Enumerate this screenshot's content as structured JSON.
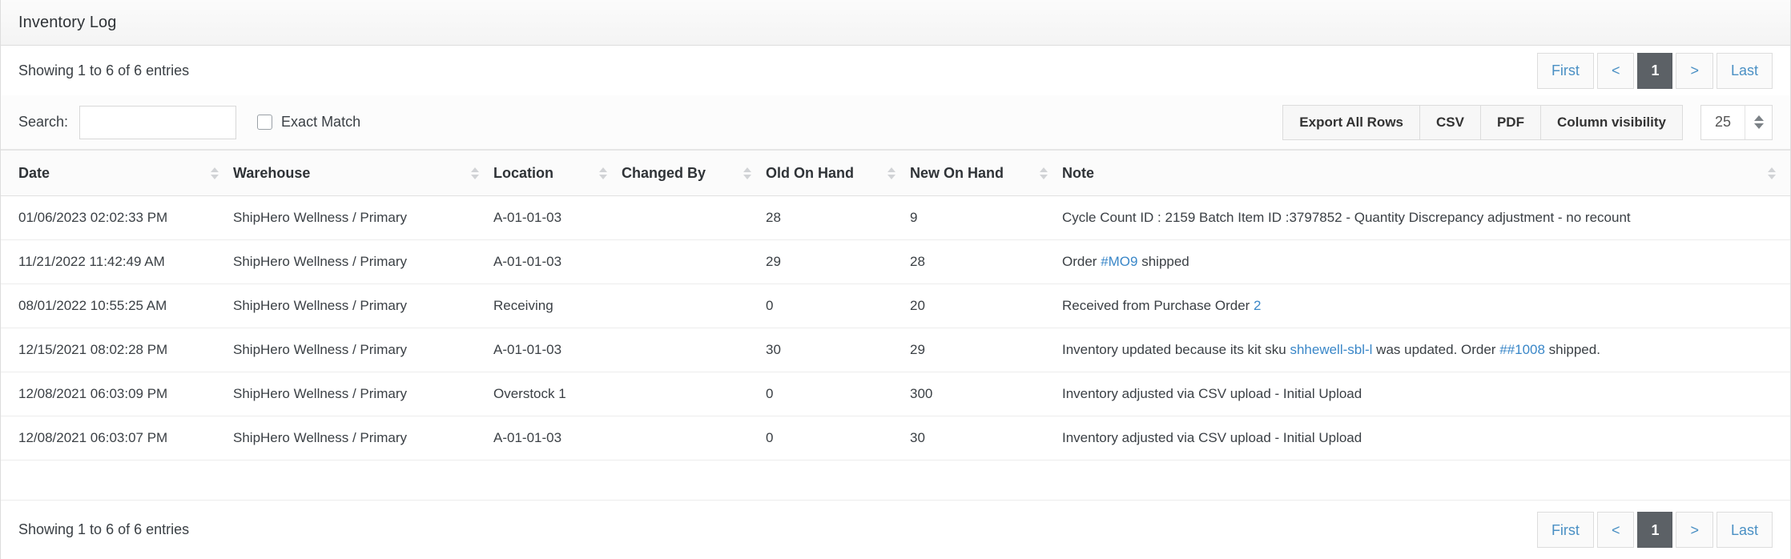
{
  "panel": {
    "title": "Inventory Log"
  },
  "top": {
    "entries_text": "Showing 1 to 6 of 6 entries",
    "pagination": {
      "first": "First",
      "prev": "<",
      "current": "1",
      "next": ">",
      "last": "Last"
    }
  },
  "search": {
    "label": "Search:",
    "value": "",
    "placeholder": "",
    "exact_match_label": "Exact Match",
    "exact_match_checked": false
  },
  "toolbar": {
    "export_all_rows": "Export All Rows",
    "csv": "CSV",
    "pdf": "PDF",
    "column_visibility": "Column visibility",
    "page_size": "25"
  },
  "table": {
    "columns": [
      {
        "label": "Date",
        "sortable": true
      },
      {
        "label": "Warehouse",
        "sortable": true
      },
      {
        "label": "Location",
        "sortable": true
      },
      {
        "label": "Changed By",
        "sortable": true
      },
      {
        "label": "Old On Hand",
        "sortable": true
      },
      {
        "label": "New On Hand",
        "sortable": true
      },
      {
        "label": "Note",
        "sortable": true
      }
    ],
    "rows": [
      {
        "date": "01/06/2023 02:02:33 PM",
        "warehouse": "ShipHero Wellness / Primary",
        "location": "A-01-01-03",
        "changed_by": "",
        "old_on_hand": "28",
        "new_on_hand": "9",
        "note_parts": [
          {
            "text": "Cycle Count ID : 2159 Batch Item ID :3797852 - Quantity Discrepancy adjustment - no recount",
            "link": false
          }
        ]
      },
      {
        "date": "11/21/2022 11:42:49 AM",
        "warehouse": "ShipHero Wellness / Primary",
        "location": "A-01-01-03",
        "changed_by": "",
        "old_on_hand": "29",
        "new_on_hand": "28",
        "note_parts": [
          {
            "text": "Order ",
            "link": false
          },
          {
            "text": "#MO9",
            "link": true
          },
          {
            "text": " shipped",
            "link": false
          }
        ]
      },
      {
        "date": "08/01/2022 10:55:25 AM",
        "warehouse": "ShipHero Wellness / Primary",
        "location": "Receiving",
        "changed_by": "",
        "old_on_hand": "0",
        "new_on_hand": "20",
        "note_parts": [
          {
            "text": "Received from Purchase Order ",
            "link": false
          },
          {
            "text": "2",
            "link": true
          }
        ]
      },
      {
        "date": "12/15/2021 08:02:28 PM",
        "warehouse": "ShipHero Wellness / Primary",
        "location": "A-01-01-03",
        "changed_by": "",
        "old_on_hand": "30",
        "new_on_hand": "29",
        "note_parts": [
          {
            "text": "Inventory updated because its kit sku ",
            "link": false
          },
          {
            "text": "shhewell-sbl-l",
            "link": true
          },
          {
            "text": " was updated. Order ",
            "link": false
          },
          {
            "text": "##1008",
            "link": true
          },
          {
            "text": " shipped.",
            "link": false
          }
        ]
      },
      {
        "date": "12/08/2021 06:03:09 PM",
        "warehouse": "ShipHero Wellness / Primary",
        "location": "Overstock 1",
        "changed_by": "",
        "old_on_hand": "0",
        "new_on_hand": "300",
        "note_parts": [
          {
            "text": "Inventory adjusted via CSV upload - Initial Upload",
            "link": false
          }
        ]
      },
      {
        "date": "12/08/2021 06:03:07 PM",
        "warehouse": "ShipHero Wellness / Primary",
        "location": "A-01-01-03",
        "changed_by": "",
        "old_on_hand": "0",
        "new_on_hand": "30",
        "note_parts": [
          {
            "text": "Inventory adjusted via CSV upload - Initial Upload",
            "link": false
          }
        ]
      }
    ]
  },
  "bottom": {
    "entries_text": "Showing 1 to 6 of 6 entries",
    "pagination": {
      "first": "First",
      "prev": "<",
      "current": "1",
      "next": ">",
      "last": "Last"
    }
  },
  "colors": {
    "link": "#3a87c8",
    "active_page_bg": "#5c6166",
    "text": "#3b4045"
  }
}
